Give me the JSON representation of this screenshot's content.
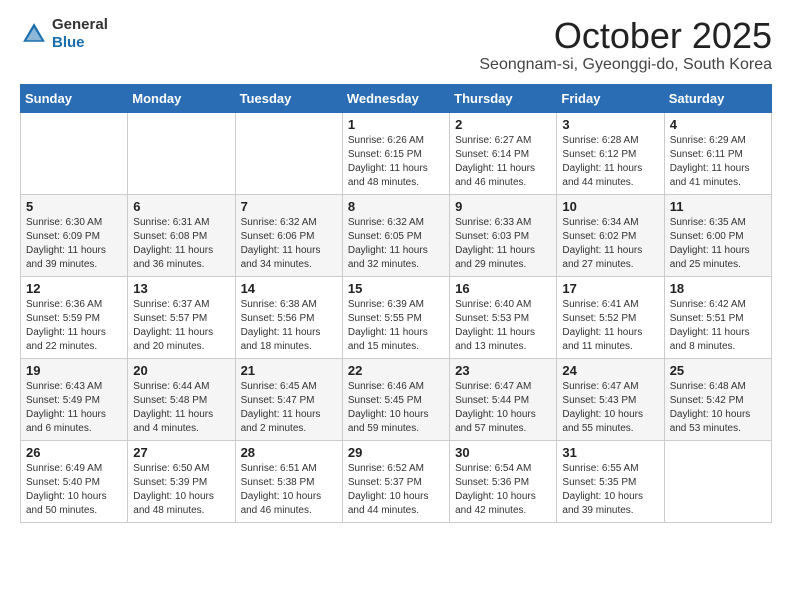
{
  "header": {
    "logo_general": "General",
    "logo_blue": "Blue",
    "month_title": "October 2025",
    "location": "Seongnam-si, Gyeonggi-do, South Korea"
  },
  "weekdays": [
    "Sunday",
    "Monday",
    "Tuesday",
    "Wednesday",
    "Thursday",
    "Friday",
    "Saturday"
  ],
  "weeks": [
    [
      {
        "day": "",
        "info": ""
      },
      {
        "day": "",
        "info": ""
      },
      {
        "day": "",
        "info": ""
      },
      {
        "day": "1",
        "info": "Sunrise: 6:26 AM\nSunset: 6:15 PM\nDaylight: 11 hours\nand 48 minutes."
      },
      {
        "day": "2",
        "info": "Sunrise: 6:27 AM\nSunset: 6:14 PM\nDaylight: 11 hours\nand 46 minutes."
      },
      {
        "day": "3",
        "info": "Sunrise: 6:28 AM\nSunset: 6:12 PM\nDaylight: 11 hours\nand 44 minutes."
      },
      {
        "day": "4",
        "info": "Sunrise: 6:29 AM\nSunset: 6:11 PM\nDaylight: 11 hours\nand 41 minutes."
      }
    ],
    [
      {
        "day": "5",
        "info": "Sunrise: 6:30 AM\nSunset: 6:09 PM\nDaylight: 11 hours\nand 39 minutes."
      },
      {
        "day": "6",
        "info": "Sunrise: 6:31 AM\nSunset: 6:08 PM\nDaylight: 11 hours\nand 36 minutes."
      },
      {
        "day": "7",
        "info": "Sunrise: 6:32 AM\nSunset: 6:06 PM\nDaylight: 11 hours\nand 34 minutes."
      },
      {
        "day": "8",
        "info": "Sunrise: 6:32 AM\nSunset: 6:05 PM\nDaylight: 11 hours\nand 32 minutes."
      },
      {
        "day": "9",
        "info": "Sunrise: 6:33 AM\nSunset: 6:03 PM\nDaylight: 11 hours\nand 29 minutes."
      },
      {
        "day": "10",
        "info": "Sunrise: 6:34 AM\nSunset: 6:02 PM\nDaylight: 11 hours\nand 27 minutes."
      },
      {
        "day": "11",
        "info": "Sunrise: 6:35 AM\nSunset: 6:00 PM\nDaylight: 11 hours\nand 25 minutes."
      }
    ],
    [
      {
        "day": "12",
        "info": "Sunrise: 6:36 AM\nSunset: 5:59 PM\nDaylight: 11 hours\nand 22 minutes."
      },
      {
        "day": "13",
        "info": "Sunrise: 6:37 AM\nSunset: 5:57 PM\nDaylight: 11 hours\nand 20 minutes."
      },
      {
        "day": "14",
        "info": "Sunrise: 6:38 AM\nSunset: 5:56 PM\nDaylight: 11 hours\nand 18 minutes."
      },
      {
        "day": "15",
        "info": "Sunrise: 6:39 AM\nSunset: 5:55 PM\nDaylight: 11 hours\nand 15 minutes."
      },
      {
        "day": "16",
        "info": "Sunrise: 6:40 AM\nSunset: 5:53 PM\nDaylight: 11 hours\nand 13 minutes."
      },
      {
        "day": "17",
        "info": "Sunrise: 6:41 AM\nSunset: 5:52 PM\nDaylight: 11 hours\nand 11 minutes."
      },
      {
        "day": "18",
        "info": "Sunrise: 6:42 AM\nSunset: 5:51 PM\nDaylight: 11 hours\nand 8 minutes."
      }
    ],
    [
      {
        "day": "19",
        "info": "Sunrise: 6:43 AM\nSunset: 5:49 PM\nDaylight: 11 hours\nand 6 minutes."
      },
      {
        "day": "20",
        "info": "Sunrise: 6:44 AM\nSunset: 5:48 PM\nDaylight: 11 hours\nand 4 minutes."
      },
      {
        "day": "21",
        "info": "Sunrise: 6:45 AM\nSunset: 5:47 PM\nDaylight: 11 hours\nand 2 minutes."
      },
      {
        "day": "22",
        "info": "Sunrise: 6:46 AM\nSunset: 5:45 PM\nDaylight: 10 hours\nand 59 minutes."
      },
      {
        "day": "23",
        "info": "Sunrise: 6:47 AM\nSunset: 5:44 PM\nDaylight: 10 hours\nand 57 minutes."
      },
      {
        "day": "24",
        "info": "Sunrise: 6:47 AM\nSunset: 5:43 PM\nDaylight: 10 hours\nand 55 minutes."
      },
      {
        "day": "25",
        "info": "Sunrise: 6:48 AM\nSunset: 5:42 PM\nDaylight: 10 hours\nand 53 minutes."
      }
    ],
    [
      {
        "day": "26",
        "info": "Sunrise: 6:49 AM\nSunset: 5:40 PM\nDaylight: 10 hours\nand 50 minutes."
      },
      {
        "day": "27",
        "info": "Sunrise: 6:50 AM\nSunset: 5:39 PM\nDaylight: 10 hours\nand 48 minutes."
      },
      {
        "day": "28",
        "info": "Sunrise: 6:51 AM\nSunset: 5:38 PM\nDaylight: 10 hours\nand 46 minutes."
      },
      {
        "day": "29",
        "info": "Sunrise: 6:52 AM\nSunset: 5:37 PM\nDaylight: 10 hours\nand 44 minutes."
      },
      {
        "day": "30",
        "info": "Sunrise: 6:54 AM\nSunset: 5:36 PM\nDaylight: 10 hours\nand 42 minutes."
      },
      {
        "day": "31",
        "info": "Sunrise: 6:55 AM\nSunset: 5:35 PM\nDaylight: 10 hours\nand 39 minutes."
      },
      {
        "day": "",
        "info": ""
      }
    ]
  ]
}
